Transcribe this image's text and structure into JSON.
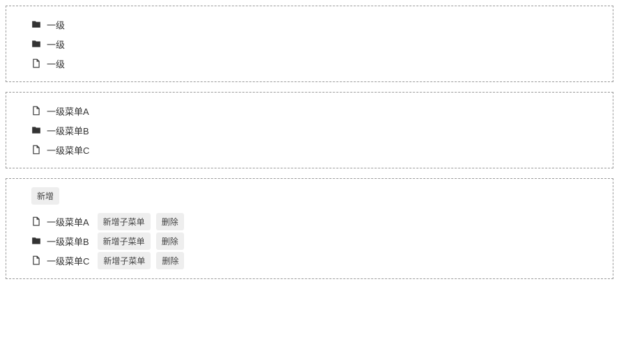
{
  "panel1": {
    "items": [
      {
        "type": "folder",
        "label": "一级"
      },
      {
        "type": "folder",
        "label": "一级"
      },
      {
        "type": "file",
        "label": "一级"
      }
    ]
  },
  "panel2": {
    "items": [
      {
        "type": "file",
        "label": "一级菜单A"
      },
      {
        "type": "folder",
        "label": "一级菜单B"
      },
      {
        "type": "file",
        "label": "一级菜单C"
      }
    ]
  },
  "panel3": {
    "add_button": "新增",
    "add_child_button": "新增子菜单",
    "delete_button": "删除",
    "items": [
      {
        "type": "file",
        "label": "一级菜单A"
      },
      {
        "type": "folder",
        "label": "一级菜单B"
      },
      {
        "type": "file",
        "label": "一级菜单C"
      }
    ]
  }
}
